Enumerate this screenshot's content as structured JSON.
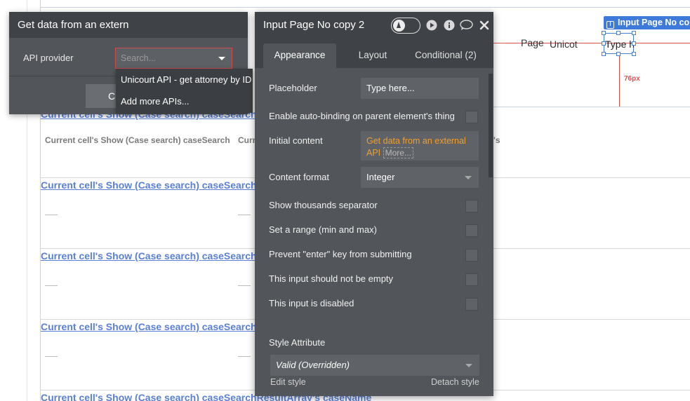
{
  "canvas": {
    "selected_element_tag": "Input Page No co",
    "page_label": "Page",
    "unicourt_label": "Unicot",
    "input_preview_text": "Type h",
    "spacing_label": "76px",
    "top_link": "Current cell's Show (Case search) caseSearchResultArray's caseName",
    "header_cell_1": "Current cell's Show (Case search) caseSearchResultArray's caseName",
    "header_cell_2": "Curr",
    "header_cell_3": "'s",
    "row_links": [
      "Current cell's Show (Case search) caseSearchResultArray's caseName",
      "Current cell's Show (Case search) caseSearchResultArray's caseName",
      "Current cell's Show (Case search) caseSearchResultArray's caseName",
      "Current cell's Show (Case search) caseSearchResultArray's caseName"
    ]
  },
  "data_source_popup": {
    "title": "Get data from an extern",
    "api_provider_label": "API provider",
    "search_placeholder": "Search...",
    "button_label": "C",
    "dropdown_options": [
      "Unicourt API - get attorney by ID",
      "Add more APIs..."
    ]
  },
  "editor": {
    "title": "Input Page No copy 2",
    "tabs": [
      "Appearance",
      "Layout",
      "Conditional (2)"
    ],
    "active_tab": "Appearance",
    "placeholder_label": "Placeholder",
    "placeholder_value": "Type here...",
    "auto_binding_label": "Enable auto-binding on parent element's thing",
    "initial_content_label": "Initial content",
    "initial_content_expr": "Get data from an external API",
    "initial_content_more": "More...",
    "content_format_label": "Content format",
    "content_format_value": "Integer",
    "checkboxes": [
      "Show thousands separator",
      "Set a range (min and max)",
      "Prevent \"enter\" key from submitting",
      "This input should not be empty",
      "This input is disabled"
    ],
    "style_attribute_label": "Style Attribute",
    "style_value": "Valid (Overridden)",
    "edit_style": "Edit style",
    "detach_style": "Detach style"
  },
  "icons": {
    "preview_toggle": "preview-toggle-icon",
    "play": "play-icon",
    "info": "info-icon",
    "comment": "comment-icon",
    "close": "close-icon",
    "input_tag": "input-element-icon"
  },
  "colors": {
    "panel_bg": "#525559",
    "panel_header": "#3f4246",
    "link_blue": "#5a7fd6",
    "selection_blue": "#3d7ad9",
    "expression_orange": "#f0a030",
    "error_red": "#e05050"
  }
}
